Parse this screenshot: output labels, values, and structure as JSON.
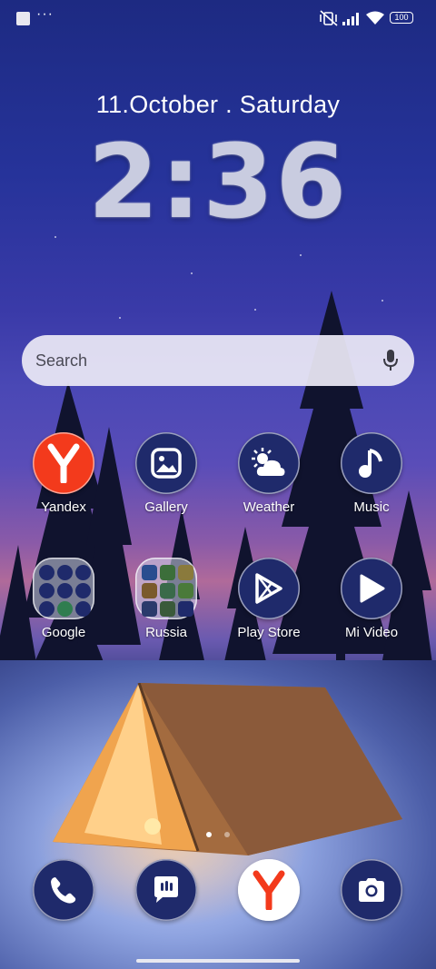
{
  "status_bar": {
    "battery": "100",
    "icons": [
      "screenshot-square-icon",
      "more-dots-icon",
      "vibrate-off-icon",
      "signal-icon",
      "wifi-icon",
      "battery-icon"
    ],
    "dots": "···"
  },
  "lockscreen": {
    "date": "11.October . Saturday",
    "time": "2:36"
  },
  "search": {
    "placeholder": "Search"
  },
  "apps_row1": [
    {
      "label": "Yandex",
      "icon": "yandex-icon"
    },
    {
      "label": "Gallery",
      "icon": "gallery-icon"
    },
    {
      "label": "Weather",
      "icon": "weather-icon"
    },
    {
      "label": "Music",
      "icon": "music-icon"
    }
  ],
  "apps_row2": [
    {
      "label": "Google",
      "icon": "google-folder-icon"
    },
    {
      "label": "Russia",
      "icon": "russia-folder-icon"
    },
    {
      "label": "Play Store",
      "icon": "play-store-icon"
    },
    {
      "label": "Mi Video",
      "icon": "mi-video-icon"
    }
  ],
  "dock": [
    {
      "icon": "phone-icon"
    },
    {
      "icon": "messages-icon"
    },
    {
      "icon": "yandex-browser-icon"
    },
    {
      "icon": "camera-icon"
    }
  ],
  "colors": {
    "icon_bg": "#1f2a6b",
    "yandex_red": "#f33a1c",
    "search_bg": "#ebe8f5"
  }
}
